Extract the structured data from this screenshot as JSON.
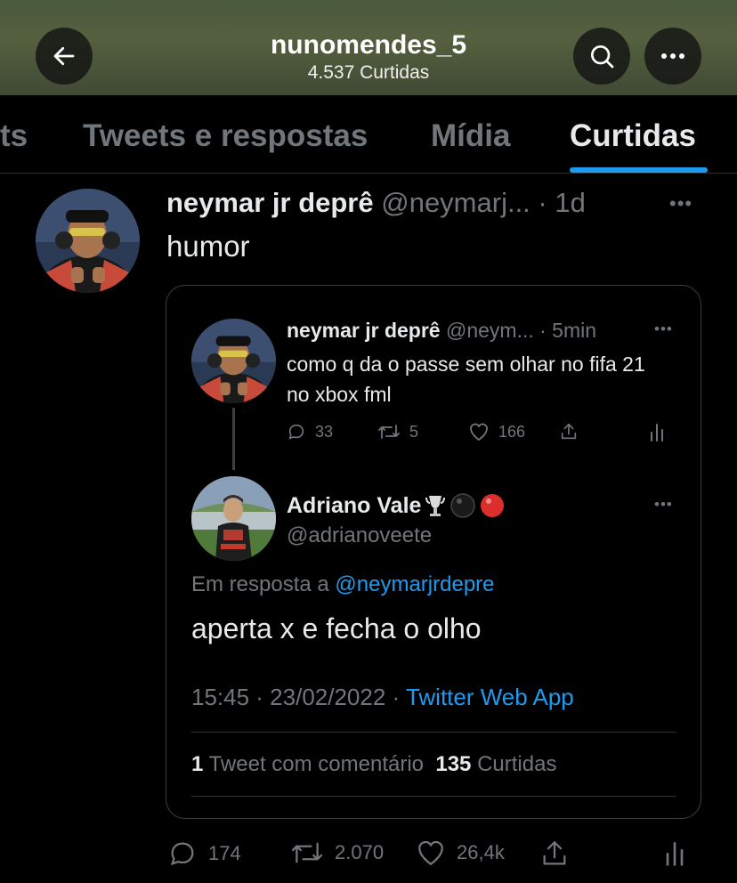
{
  "header": {
    "title": "nunomendes_5",
    "subtitle": "4.537 Curtidas"
  },
  "tabs": [
    {
      "label": "ts"
    },
    {
      "label": "Tweets e respostas"
    },
    {
      "label": "Mídia"
    },
    {
      "label": "Curtidas",
      "active": true
    }
  ],
  "tweet": {
    "name": "neymar jr deprê",
    "handle_time": "@neymarj... · 1d",
    "text": "humor",
    "actions": {
      "replies": "174",
      "retweets": "2.070",
      "likes": "26,4k"
    }
  },
  "quote": {
    "parent": {
      "name": "neymar jr deprê",
      "handle_time": "@neym... · 5min",
      "text": "como q da o passe sem olhar no fifa 21 no xbox fml",
      "actions": {
        "replies": "33",
        "retweets": "5",
        "likes": "166"
      }
    },
    "reply": {
      "name": "Adriano Vale",
      "handle": "@adrianoveete",
      "reply_prefix": "Em resposta a",
      "mention": "@neymarjrdepre",
      "text": "aperta x e fecha o olho",
      "timestamp": "15:45 · 23/02/2022 · ",
      "app": "Twitter Web App",
      "stats": {
        "quote_count": "1",
        "quote_label": " Tweet com comentário  ",
        "like_count": "135",
        "like_label": " Curtidas"
      }
    }
  },
  "colors": {
    "accent": "#1d9bf0",
    "muted": "#71767b",
    "text": "#e7e9ea"
  }
}
